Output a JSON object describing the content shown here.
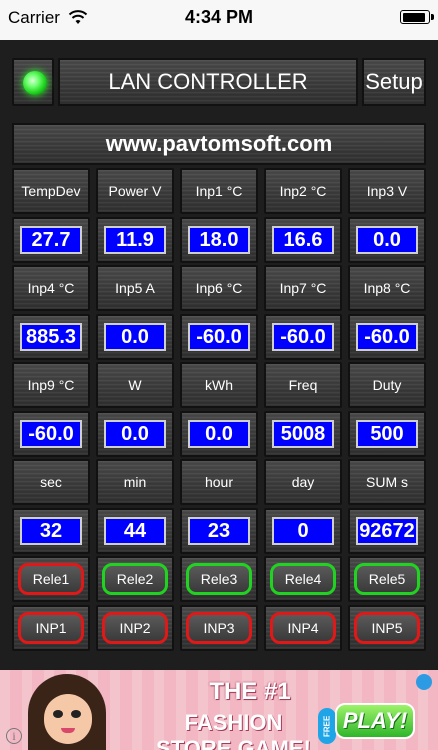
{
  "status_bar": {
    "carrier": "Carrier",
    "time": "4:34 PM",
    "battery_level": 0.9
  },
  "header": {
    "title": "LAN CONTROLLER",
    "setup_label": "Setup",
    "led_color": "#2dff2d"
  },
  "url": "www.pavtomsoft.com",
  "grid": {
    "labels_row1": [
      "TempDev",
      "Power V",
      "Inp1 °C",
      "Inp2 °C",
      "Inp3 V"
    ],
    "values_row1": [
      "27.7",
      "11.9",
      "18.0",
      "16.6",
      "0.0"
    ],
    "labels_row2": [
      "Inp4 °C",
      "Inp5 A",
      "Inp6 °C",
      "Inp7 °C",
      "Inp8 °C"
    ],
    "values_row2": [
      "885.3",
      "0.0",
      "-60.0",
      "-60.0",
      "-60.0"
    ],
    "labels_row3": [
      "Inp9 °C",
      "W",
      "kWh",
      "Freq",
      "Duty"
    ],
    "values_row3": [
      "-60.0",
      "0.0",
      "0.0",
      "5008",
      "500"
    ],
    "labels_row4": [
      "sec",
      "min",
      "hour",
      "day",
      "SUM s"
    ],
    "values_row4": [
      "32",
      "44",
      "23",
      "0",
      "92672"
    ],
    "relays": [
      "Rele1",
      "Rele2",
      "Rele3",
      "Rele4",
      "Rele5"
    ],
    "relay_states": [
      "red",
      "green",
      "green",
      "green",
      "green"
    ],
    "inputs": [
      "INP1",
      "INP2",
      "INP3",
      "INP4",
      "INP5"
    ],
    "input_states": [
      "red",
      "red",
      "red",
      "red",
      "red"
    ]
  },
  "ad": {
    "line1": "THE #1",
    "line2": "FASHION STORE GAME!",
    "badge": "FREE",
    "play_label": "PLAY!",
    "info_glyph": "i"
  },
  "colors": {
    "value_box": "#0000ff",
    "relay_on": "#21d321",
    "relay_off": "#e01818"
  }
}
